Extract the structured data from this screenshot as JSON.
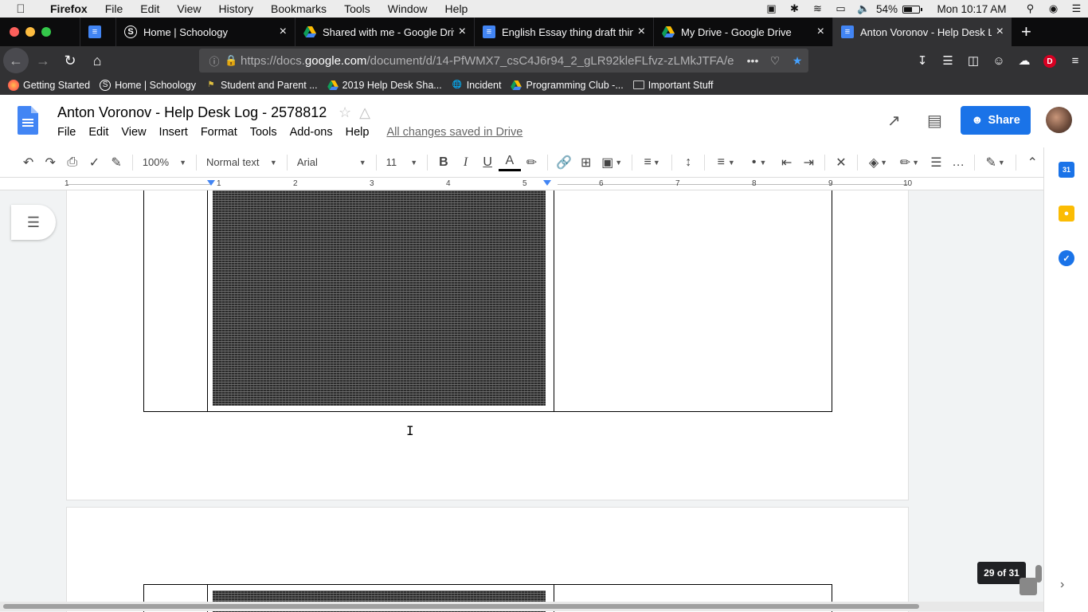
{
  "mac_menubar": {
    "apple_icon": "apple-logo-icon",
    "app_name": "Firefox",
    "items": [
      "File",
      "Edit",
      "View",
      "History",
      "Bookmarks",
      "Tools",
      "Window",
      "Help"
    ],
    "battery_percent": "54%",
    "battery_level": 0.54,
    "clock": "Mon 10:17 AM"
  },
  "tabs": [
    {
      "title": "",
      "favicon": "docs-icon",
      "pinned": true
    },
    {
      "title": "Home | Schoology",
      "favicon": "schoology-icon"
    },
    {
      "title": "Shared with me - Google Drive",
      "favicon": "drive-icon"
    },
    {
      "title": "English Essay thing draft thing",
      "favicon": "docs-icon"
    },
    {
      "title": "My Drive - Google Drive",
      "favicon": "drive-icon"
    },
    {
      "title": "Anton Voronov - Help Desk Log",
      "favicon": "docs-icon",
      "active": true
    }
  ],
  "newtab_label": "+",
  "navbar": {
    "url_prefix": "https://docs.",
    "url_domain": "google.com",
    "url_rest": "/document/d/14-PfWMX7_csC4J6r94_2_gLR92kleFLfvz-zLMkJTFA/e",
    "more_label": "•••",
    "account_initial": "D"
  },
  "bookmarks": [
    {
      "label": "Getting Started",
      "icon": "firefox-icon"
    },
    {
      "label": "Home | Schoology",
      "icon": "schoology-icon"
    },
    {
      "label": "Student and Parent ...",
      "icon": "pearson-icon"
    },
    {
      "label": "2019 Help Desk Sha...",
      "icon": "drive-icon"
    },
    {
      "label": "Incident",
      "icon": "globe-icon"
    },
    {
      "label": "Programming Club -...",
      "icon": "drive-icon"
    },
    {
      "label": "Important Stuff",
      "icon": "folder-icon"
    }
  ],
  "docs": {
    "title": "Anton Voronov - Help Desk Log - 2578812",
    "menu": [
      "File",
      "Edit",
      "View",
      "Insert",
      "Format",
      "Tools",
      "Add-ons",
      "Help"
    ],
    "save_status": "All changes saved in Drive",
    "share_label": "Share"
  },
  "toolbar": {
    "zoom": "100%",
    "style": "Normal text",
    "font": "Arial",
    "font_size": "11",
    "bold": "B",
    "italic": "I",
    "underline": "U",
    "text_color_letter": "A"
  },
  "ruler": {
    "numbers": [
      "1",
      "1",
      "2",
      "3",
      "4",
      "5",
      "6",
      "7",
      "8",
      "9",
      "10"
    ]
  },
  "page_indicator": "29 of 31",
  "side_panel": {
    "calendar_label": "31"
  }
}
